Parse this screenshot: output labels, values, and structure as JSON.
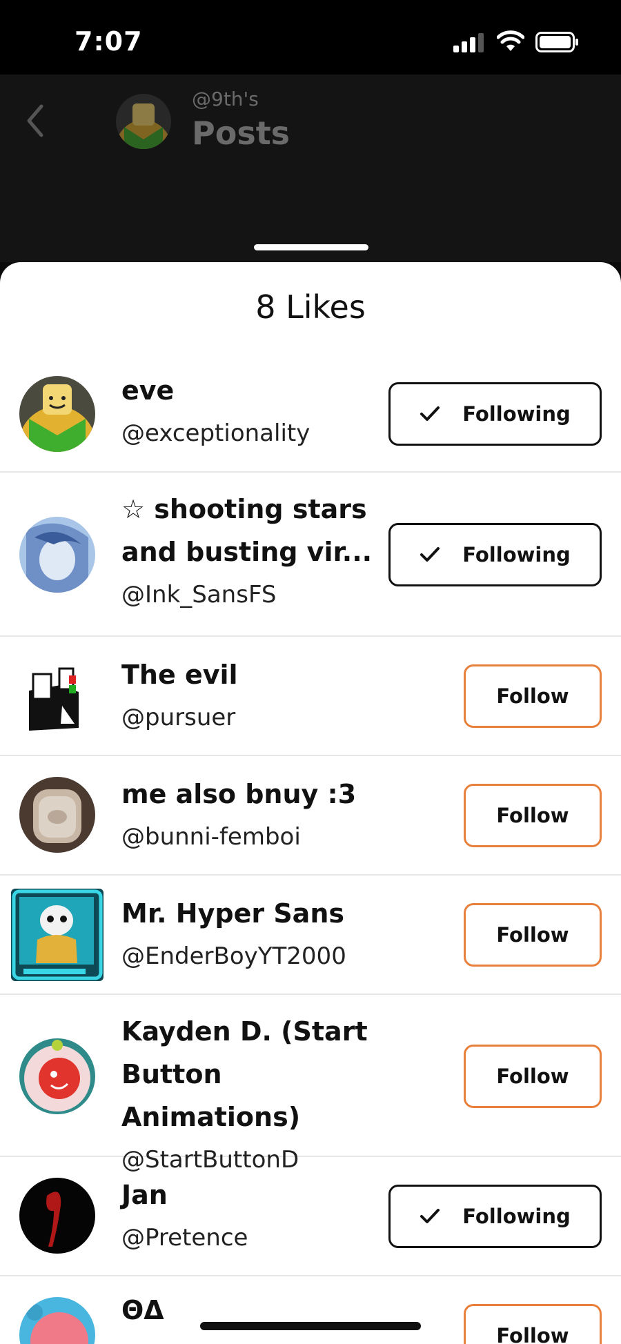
{
  "status_bar": {
    "time": "7:07"
  },
  "header": {
    "subtitle": "@9th's",
    "title": "Posts"
  },
  "sheet": {
    "title": "8 Likes"
  },
  "users": [
    {
      "name": "eve",
      "handle": "@exceptionality",
      "button": "Following",
      "following": true
    },
    {
      "name": "☆ shooting stars and busting vir...",
      "handle": "@Ink_SansFS",
      "button": "Following",
      "following": true
    },
    {
      "name": "The evil",
      "handle": "@pursuer",
      "button": "Follow",
      "following": false
    },
    {
      "name": "me also bnuy :3",
      "handle": "@bunni-femboi",
      "button": "Follow",
      "following": false
    },
    {
      "name": "Mr. Hyper Sans",
      "handle": "@EnderBoyYT2000",
      "button": "Follow",
      "following": false
    },
    {
      "name": "Kayden D. (Start Button Animations)",
      "handle": "@StartButtonD",
      "button": "Follow",
      "following": false
    },
    {
      "name": "Jan",
      "handle": "@Pretence",
      "button": "Following",
      "following": true
    },
    {
      "name": "ΘΔ",
      "handle": "",
      "button": "Follow",
      "following": false
    }
  ],
  "colors": {
    "follow_border": "#e8803c",
    "following_border": "#111111",
    "background": "#141414"
  }
}
